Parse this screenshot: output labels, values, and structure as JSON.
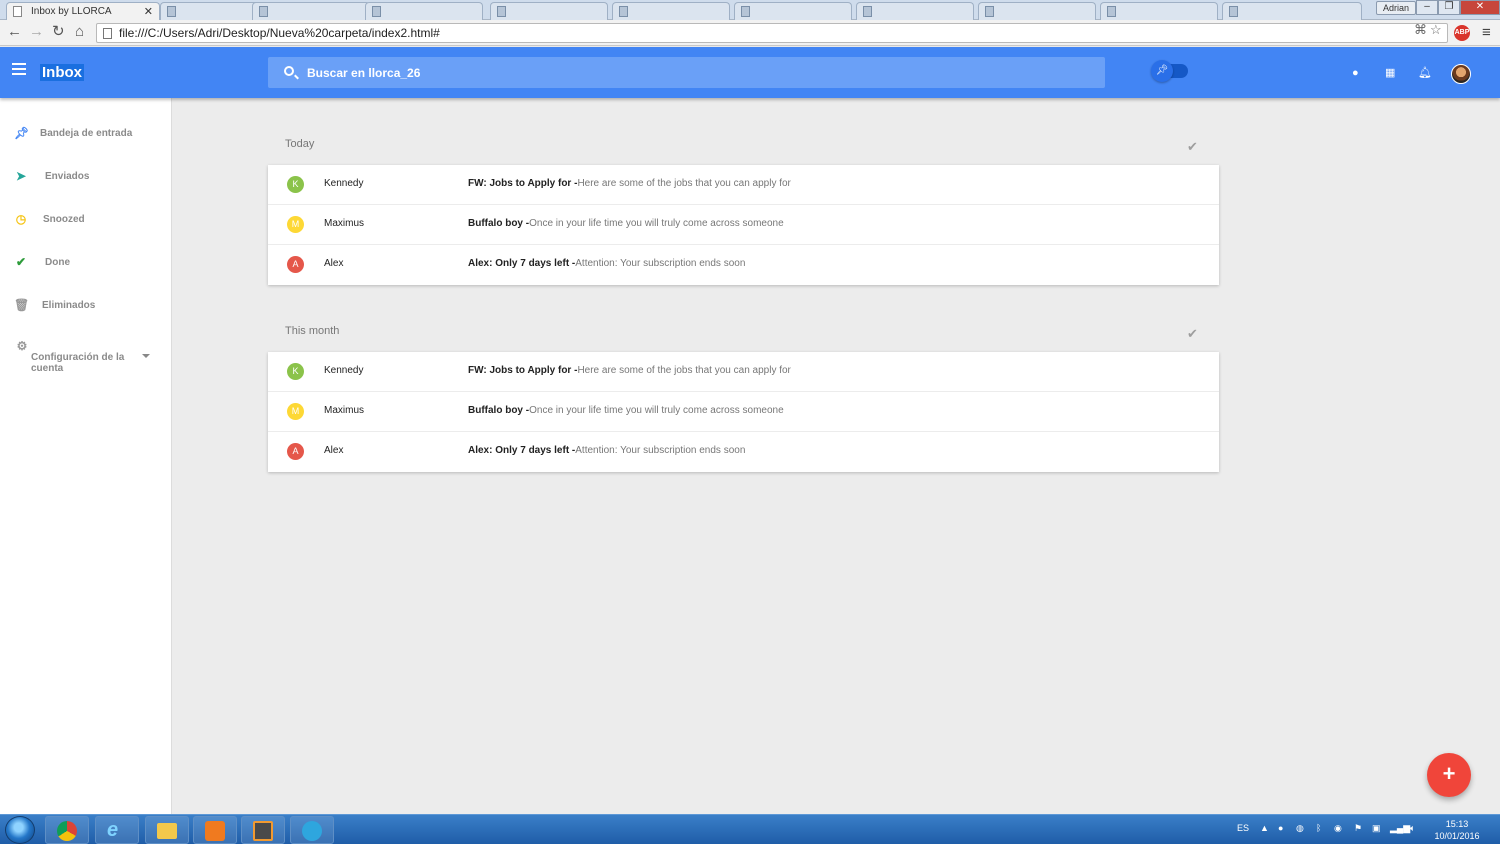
{
  "browser": {
    "active_tab_title": "Inbox by LLORCA",
    "user_badge": "Adrian",
    "url": "file:///C:/Users/Adri/Desktop/Nueva%20carpeta/index2.html#",
    "abp_label": "ABP"
  },
  "app": {
    "brand": "Inbox",
    "search_placeholder": "Buscar en llorca_26",
    "colors": {
      "primary": "#4285f4",
      "fab": "#f0453a"
    }
  },
  "sidebar": {
    "items": [
      {
        "label": "Bandeja de entrada",
        "icon": "pin-icon"
      },
      {
        "label": "Enviados",
        "icon": "send-icon"
      },
      {
        "label": "Snoozed",
        "icon": "clock-icon"
      },
      {
        "label": "Done",
        "icon": "check-icon"
      },
      {
        "label": "Eliminados",
        "icon": "trash-icon"
      },
      {
        "label": "Configuración de la cuenta",
        "icon": "gear-icon"
      }
    ]
  },
  "sections": [
    {
      "title": "Today",
      "rows": [
        {
          "initial": "K",
          "color": "#8bc34a",
          "sender": "Kennedy",
          "subject": "FW: Jobs to Apply for -",
          "snippet": "Here are some of the jobs that you can apply for"
        },
        {
          "initial": "M",
          "color": "#fdd835",
          "sender": "Maximus",
          "subject": "Buffalo boy -",
          "snippet": "Once in your life time you will truly come across someone"
        },
        {
          "initial": "A",
          "color": "#e5574a",
          "sender": "Alex",
          "subject": "Alex: Only 7 days left -",
          "snippet": "Attention: Your subscription ends soon"
        }
      ]
    },
    {
      "title": "This month",
      "rows": [
        {
          "initial": "K",
          "color": "#8bc34a",
          "sender": "Kennedy",
          "subject": "FW: Jobs to Apply for -",
          "snippet": "Here are some of the jobs that you can apply for"
        },
        {
          "initial": "M",
          "color": "#fdd835",
          "sender": "Maximus",
          "subject": "Buffalo boy -",
          "snippet": "Once in your life time you will truly come across someone"
        },
        {
          "initial": "A",
          "color": "#e5574a",
          "sender": "Alex",
          "subject": "Alex: Only 7 days left -",
          "snippet": "Attention: Your subscription ends soon"
        }
      ]
    }
  ],
  "taskbar": {
    "language": "ES",
    "time": "15:13",
    "date": "10/01/2016"
  }
}
